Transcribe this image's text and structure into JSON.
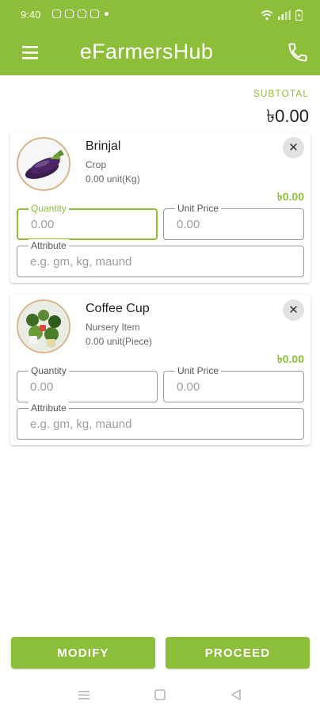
{
  "status_bar": {
    "time": "9:40"
  },
  "app": {
    "title": "eFarmersHub"
  },
  "icons": {
    "menu": "menu-icon",
    "phone": "phone-icon",
    "close": "close-icon",
    "nav_recents": "recents-icon",
    "nav_home": "home-icon",
    "nav_back": "back-icon"
  },
  "colors": {
    "primary": "#8dbe3a",
    "text": "#1f1f1f",
    "muted": "#666666"
  },
  "subtotal": {
    "label": "SUBTOTAL",
    "value": "৳0.00"
  },
  "items": [
    {
      "name": "Brinjal",
      "category": "Crop",
      "unit_text": "0.00 unit(Kg)",
      "total": "৳0.00",
      "fields": {
        "quantity": {
          "label": "Quantity",
          "value": "",
          "placeholder": "0.00"
        },
        "unit_price": {
          "label": "Unit Price",
          "value": "",
          "placeholder": "0.00"
        },
        "attribute": {
          "label": "Attribute",
          "value": "",
          "placeholder": "e.g. gm, kg, maund"
        }
      }
    },
    {
      "name": "Coffee Cup",
      "category": "Nursery Item",
      "unit_text": "0.00 unit(Piece)",
      "total": "৳0.00",
      "fields": {
        "quantity": {
          "label": "Quantity",
          "value": "",
          "placeholder": "0.00"
        },
        "unit_price": {
          "label": "Unit Price",
          "value": "",
          "placeholder": "0.00"
        },
        "attribute": {
          "label": "Attribute",
          "value": "",
          "placeholder": "e.g. gm, kg, maund"
        }
      }
    }
  ],
  "buttons": {
    "modify": "MODIFY",
    "proceed": "PROCEED"
  }
}
